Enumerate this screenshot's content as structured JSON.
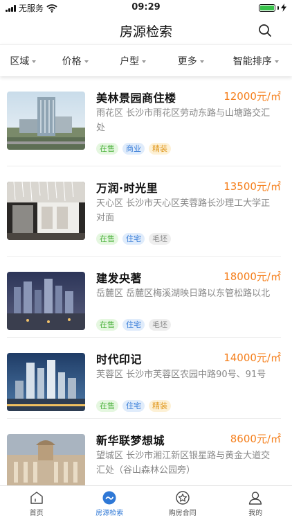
{
  "status_bar": {
    "carrier": "无服务",
    "time": "09:29"
  },
  "nav": {
    "title": "房源检索"
  },
  "filters": [
    "区域",
    "价格",
    "户型",
    "更多",
    "智能排序"
  ],
  "listings": [
    {
      "name": "美林景园商住楼",
      "price": "12000元/㎡",
      "address": "雨花区 长沙市雨花区劳动东路与山塘路交汇处",
      "tags": [
        {
          "text": "在售",
          "color": "green"
        },
        {
          "text": "商业",
          "color": "blue"
        },
        {
          "text": "精装",
          "color": "orange"
        }
      ]
    },
    {
      "name": "万润·时光里",
      "price": "13500元/㎡",
      "address": "天心区 长沙市天心区芙蓉路长沙理工大学正对面",
      "tags": [
        {
          "text": "在售",
          "color": "green"
        },
        {
          "text": "住宅",
          "color": "blue"
        },
        {
          "text": "毛坯",
          "color": "gray"
        }
      ]
    },
    {
      "name": "建发央著",
      "price": "18000元/㎡",
      "address": "岳麓区 岳麓区梅溪湖映日路以东管松路以北",
      "tags": [
        {
          "text": "在售",
          "color": "green"
        },
        {
          "text": "住宅",
          "color": "blue"
        },
        {
          "text": "毛坯",
          "color": "gray"
        }
      ]
    },
    {
      "name": "时代印记",
      "price": "14000元/㎡",
      "address": "芙蓉区 长沙市芙蓉区农园中路90号、91号",
      "tags": [
        {
          "text": "在售",
          "color": "green"
        },
        {
          "text": "住宅",
          "color": "blue"
        },
        {
          "text": "精装",
          "color": "orange"
        }
      ]
    },
    {
      "name": "新华联梦想城",
      "price": "8600元/㎡",
      "address": "望城区 长沙市湘江新区银星路与黄金大道交汇处（谷山森林公园旁）",
      "tags": []
    }
  ],
  "tabs": [
    {
      "label": "首页",
      "icon": "home-icon",
      "active": false
    },
    {
      "label": "房源检索",
      "icon": "search-house-icon",
      "active": true
    },
    {
      "label": "购房合同",
      "icon": "star-icon",
      "active": false
    },
    {
      "label": "我的",
      "icon": "user-icon",
      "active": false
    }
  ],
  "colors": {
    "price": "#f5801e",
    "accent": "#2f78d6",
    "tag_green": "#4bb13c",
    "tag_blue": "#3a7ed8",
    "tag_orange": "#e19a22",
    "tag_gray": "#888888"
  }
}
